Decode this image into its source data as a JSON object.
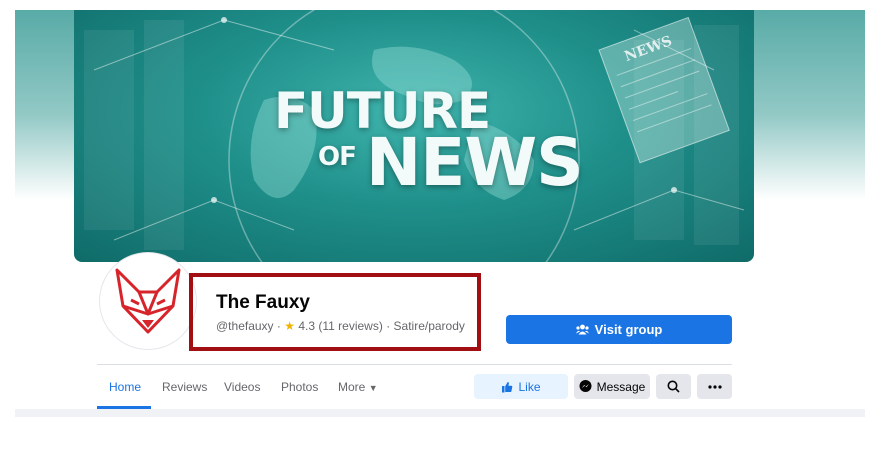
{
  "cover": {
    "title_line1": "FUTURE",
    "title_line2a": "OF",
    "title_line2b": "NEWS",
    "newspaper_label": "NEWS"
  },
  "profile": {
    "name": "The Fauxy",
    "handle": "@thefauxy",
    "rating": "4.3",
    "reviews": "(11 reviews)",
    "category": "Satire/parody",
    "separator": "·"
  },
  "actions": {
    "visit_group": "Visit group",
    "like": "Like",
    "message": "Message"
  },
  "tabs": [
    {
      "label": "Home"
    },
    {
      "label": "Reviews"
    },
    {
      "label": "Videos"
    },
    {
      "label": "Photos"
    },
    {
      "label": "More"
    }
  ],
  "colors": {
    "accent": "#1b74e4",
    "highlight_box": "#a10f13",
    "cover_teal": "#1f8f8a"
  }
}
